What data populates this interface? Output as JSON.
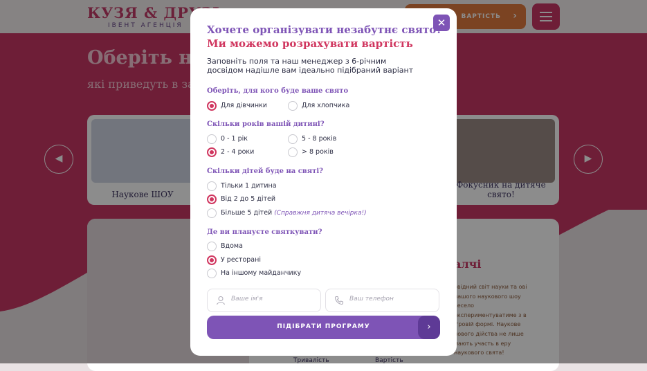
{
  "colors": {
    "brand": "#c83865",
    "accent": "#7e54b6",
    "selected": "#d0365f",
    "orange": "#e07b3f"
  },
  "header": {
    "logo_main": "КУЗЯ & ДРУЗІ",
    "logo_sub": "ІВЕНТ АГЕНЦІЯ",
    "cta_label": "ВАРТІСТЬ",
    "cta_icon": "chevron-right-icon",
    "menu_icon": "menu-icon"
  },
  "hero": {
    "title": "Оберіть неймо",
    "subtitle": "які приведуть в захват"
  },
  "cards": [
    {
      "label": "Наукове ШОУ"
    },
    {
      "label": "Фокусник на дитяче свято!"
    }
  ],
  "info": {
    "title": "алчі",
    "text": "овідний світ науки та ові нашого наукового шоу весело експериментуватиме з в ігровій формі. Наукове нового дійства не лише мають участь в еру наукового свята!",
    "meta_duration": "Тривалість",
    "meta_price": "Вартість"
  },
  "modal": {
    "title_line1": "Хочете організувати незабутнє свято?",
    "title_line2": "Ми можемо розрахувати вартість",
    "description": "Заповніть поля та наш менеджер з 6-річним досвідом надішле вам ідеально підібраний варіант",
    "close_icon": "close-icon",
    "questions": [
      {
        "title": "Оберіть, для кого буде ваше свято",
        "options": [
          {
            "label": "Для дівчинки",
            "selected": true
          },
          {
            "label": "Для хлопчика",
            "selected": false
          }
        ]
      },
      {
        "title": "Скільки років вашій дитині?",
        "options": [
          {
            "label": "0 - 1 рік",
            "selected": false
          },
          {
            "label": "5 - 8 років",
            "selected": false
          },
          {
            "label": "2 - 4 роки",
            "selected": true
          },
          {
            "label": "> 8 років",
            "selected": false
          }
        ]
      },
      {
        "title": "Скільки дітей буде на святі?",
        "options": [
          {
            "label": "Тільки 1 дитина",
            "selected": false
          },
          {
            "label": "Від 2 до 5 дітей",
            "selected": true
          },
          {
            "label": "Більше 5 дітей",
            "note": "(Справжня дитяча вечірка!)",
            "selected": false
          }
        ]
      },
      {
        "title": "Де ви плануєте святкувати?",
        "options": [
          {
            "label": "Вдома",
            "selected": false
          },
          {
            "label": "У ресторані",
            "selected": true
          },
          {
            "label": "На іншому майданчику",
            "selected": false
          }
        ]
      }
    ],
    "name_placeholder": "Ваше ім'я",
    "phone_placeholder": "Ваш телефон",
    "submit_label": "ПІДІБРАТИ ПРОГРАМУ"
  }
}
